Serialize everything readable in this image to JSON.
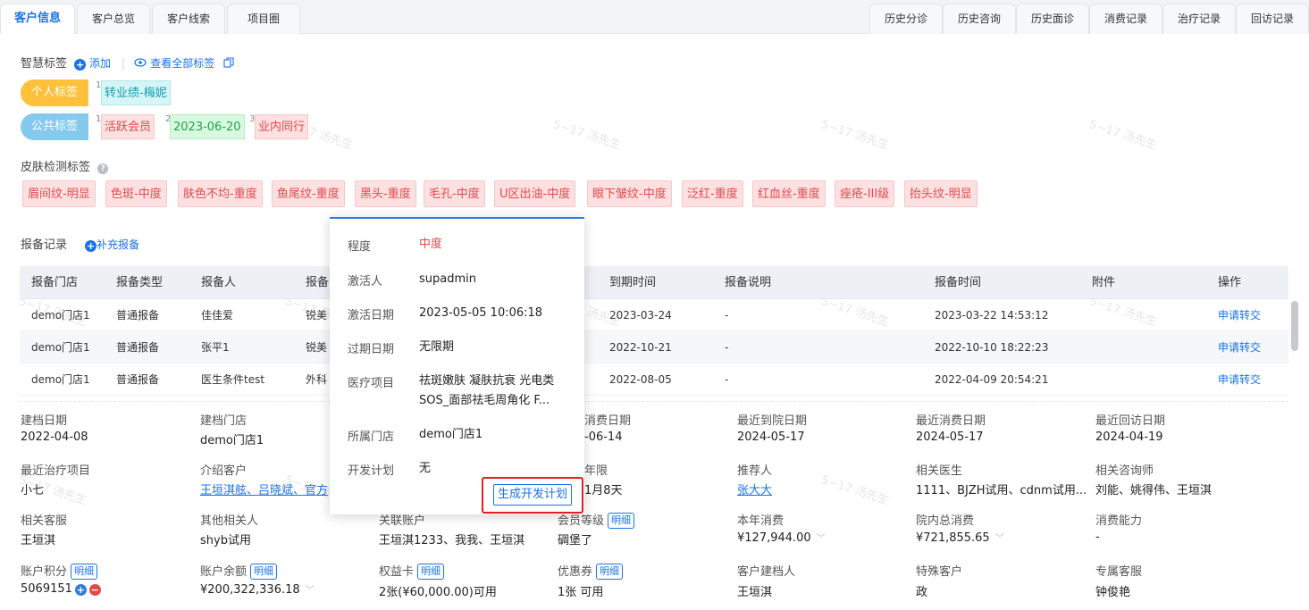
{
  "tabs_left": [
    "客户信息",
    "客户总览",
    "客户线索",
    "项目圈"
  ],
  "tabs_right": [
    "历史分诊",
    "历史咨询",
    "历史面诊",
    "消费记录",
    "治疗记录",
    "回访记录"
  ],
  "smart_tags": {
    "title": "智慧标签",
    "add": "添加",
    "view_all": "查看全部标签",
    "personal_label": "个人标签",
    "personal": [
      {
        "num": "1",
        "text": "转业绩-梅妮"
      }
    ],
    "public_label": "公共标签",
    "public": [
      {
        "num": "1",
        "text": "活跃会员"
      },
      {
        "num": "2",
        "text": "2023-06-20"
      },
      {
        "num": "3",
        "text": "业内同行"
      }
    ]
  },
  "skin": {
    "title": "皮肤检测标签",
    "tags": [
      "眉间纹-明显",
      "色斑-中度",
      "肤色不均-重度",
      "鱼尾纹-重度",
      "黑头-重度",
      "毛孔-中度",
      "U区出油-中度",
      "眼下皱纹-中度",
      "泛红-重度",
      "红血丝-重度",
      "痤疮-III级",
      "抬头纹-明显"
    ]
  },
  "report": {
    "title": "报备记录",
    "add": "补充报备",
    "columns": [
      "报备门店",
      "报备类型",
      "报备人",
      "报备",
      "到期时间",
      "报备说明",
      "报备时间",
      "附件",
      "操作"
    ],
    "rows": [
      {
        "store": "demo门店1",
        "type": "普通报备",
        "person": "佳佳爱",
        "cat": "锐美",
        "expire": "2023-03-24",
        "desc": "-",
        "time": "2023-03-22 14:53:12",
        "action": "申请转交"
      },
      {
        "store": "demo门店1",
        "type": "普通报备",
        "person": "张平1",
        "cat": "锐美",
        "expire": "2022-10-21",
        "desc": "-",
        "time": "2022-10-10 18:22:23",
        "action": "申请转交"
      },
      {
        "store": "demo门店1",
        "type": "普通报备",
        "person": "医生条件test",
        "cat": "外科",
        "expire": "2022-08-05",
        "desc": "-",
        "time": "2022-04-09 20:54:21",
        "action": "申请转交"
      }
    ]
  },
  "info": {
    "r1": [
      {
        "label": "建档日期",
        "value": "2022-04-08"
      },
      {
        "label": "建档门店",
        "value": "demo门店1"
      },
      {
        "label": "消费日期",
        "value": "-06-14"
      },
      {
        "label": "最近到院日期",
        "value": "2024-05-17"
      },
      {
        "label": "最近消费日期",
        "value": "2024-05-17"
      },
      {
        "label": "最近回访日期",
        "value": "2024-04-19"
      }
    ],
    "r2": [
      {
        "label": "最近治疗项目",
        "value": "小七"
      },
      {
        "label": "介绍客户",
        "value": "王垣淇舷、吕晓斌、官方"
      },
      {
        "label": "年限",
        "value": "1月8天"
      },
      {
        "label": "推荐人",
        "value": "张大大"
      },
      {
        "label": "相关医生",
        "value": "1111、BJZH试用、cdnm试用..."
      },
      {
        "label": "相关咨询师",
        "value": "刘能、姚得伟、王垣淇"
      }
    ],
    "r3": [
      {
        "label": "相关客服",
        "value": "王垣淇"
      },
      {
        "label": "其他相关人",
        "value": "shyb试用"
      },
      {
        "label": "关联账户",
        "value": "王垣淇1233、我我、王垣淇"
      },
      {
        "label": "会员等级",
        "value": "碉堡了"
      },
      {
        "label": "本年消费",
        "value": "¥127,944.00"
      },
      {
        "label": "院内总消费",
        "value": "¥721,855.65"
      },
      {
        "label": "消费能力",
        "value": "-"
      }
    ],
    "r4": [
      {
        "label": "账户积分",
        "value": "5069151"
      },
      {
        "label": "账户余额",
        "value": "¥200,322,336.18"
      },
      {
        "label": "权益卡",
        "value": "2张(¥60,000.00)可用"
      },
      {
        "label": "优惠券",
        "value": "1张 可用"
      },
      {
        "label": "客户建档人",
        "value": "王垣淇"
      },
      {
        "label": "特殊客户",
        "value": "政"
      },
      {
        "label": "专属客服",
        "value": "钟俊艳"
      }
    ],
    "detail": "明细"
  },
  "popover": {
    "level_label": "程度",
    "level": "中度",
    "activator_label": "激活人",
    "activator": "supadmin",
    "activate_date_label": "激活日期",
    "activate_date": "2023-05-05 10:06:18",
    "expire_label": "过期日期",
    "expire": "无限期",
    "project_label": "医疗项目",
    "project_line1": "祛斑嫩肤 凝肤抗衰 光电类",
    "project_line2": "SOS_面部祛毛周角化 F...",
    "store_label": "所属门店",
    "store": "demo门店1",
    "plan_label": "开发计划",
    "plan": "无",
    "generate": "生成开发计划"
  },
  "watermark": "5~17 汤先生",
  "colors": {
    "accent": "#1a73e8",
    "tag_red": "#e24a4a",
    "highlight": "#e02020"
  }
}
